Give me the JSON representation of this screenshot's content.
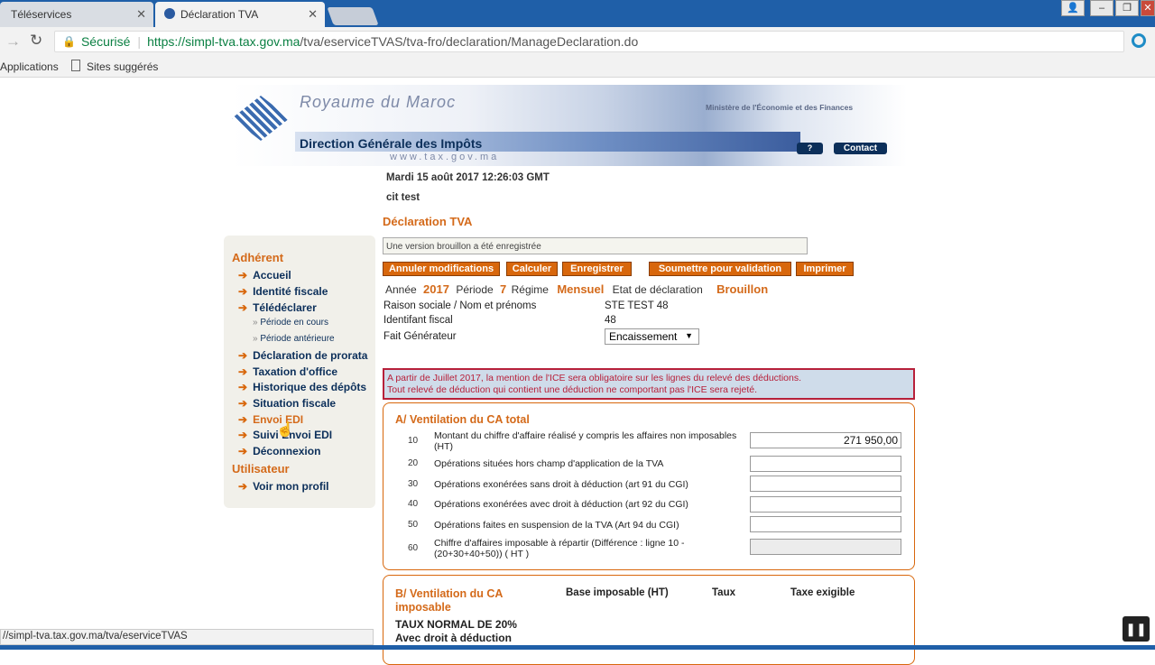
{
  "browser": {
    "tabs": [
      {
        "label": "Téléservices",
        "active": false
      },
      {
        "label": "Déclaration TVA",
        "active": true
      }
    ],
    "secure_label": "Sécurisé",
    "url_host": "https://simpl-tva.tax.gov.ma",
    "url_path": "/tva/eserviceTVAS/tva-fro/declaration/ManageDeclaration.do",
    "bookmarks": [
      "Applications",
      "Sites suggérés"
    ],
    "status_url": "//simpl-tva.tax.gov.ma/tva/eserviceTVAS"
  },
  "banner": {
    "kingdom": "Royaume du Maroc",
    "ministry": "Ministère de l'Économie et des Finances",
    "direction": "Direction Générale des Impôts",
    "website": "www.tax.gov.ma",
    "help_label": "?",
    "contact_label": "Contact"
  },
  "header": {
    "datetime": "Mardi 15 août 2017 12:26:03 GMT",
    "user": "cit test",
    "page_title": "Déclaration TVA"
  },
  "sidebar": {
    "section1": "Adhérent",
    "items": [
      "Accueil",
      "Identité fiscale",
      "Télédéclarer",
      "Déclaration de prorata",
      "Taxation d'office",
      "Historique des dépôts",
      "Situation fiscale",
      "Envoi EDI",
      "Suivi Envoi EDI",
      "Déconnexion"
    ],
    "subitems": [
      "Période en cours",
      "Période antérieure"
    ],
    "section2": "Utilisateur",
    "items2": [
      "Voir mon profil"
    ]
  },
  "notice": "Une version brouillon a été enregistrée",
  "buttons": {
    "cancel": "Annuler modifications",
    "calc": "Calculer",
    "save": "Enregistrer",
    "submit": "Soumettre pour validation",
    "print": "Imprimer"
  },
  "decl": {
    "annee_label": "Année",
    "annee": "2017",
    "periode_label": "Période",
    "periode": "7",
    "regime_label": "Régime",
    "regime": "Mensuel",
    "etat_label": "Etat de déclaration",
    "etat": "Brouillon",
    "raison_label": "Raison sociale / Nom et prénoms",
    "raison": "STE TEST 48",
    "if_label": "Identifant fiscal",
    "if": "48",
    "fait_label": "Fait Générateur",
    "fait": "Encaissement"
  },
  "alert": {
    "line1": "A partir de Juillet 2017, la mention de l'ICE sera obligatoire sur les lignes du relevé des déductions.",
    "line2": "Tout relevé de déduction qui contient une déduction ne comportant pas l'ICE sera rejeté."
  },
  "sectionA": {
    "title": "A/ Ventilation du CA total",
    "rows": [
      {
        "num": "10",
        "label": "Montant du chiffre d'affaire réalisé y compris les affaires non imposables (HT)",
        "value": "271 950,00"
      },
      {
        "num": "20",
        "label": "Opérations situées hors champ d'application de la TVA",
        "value": ""
      },
      {
        "num": "30",
        "label": "Opérations exonérées sans droit à déduction (art 91 du CGI)",
        "value": ""
      },
      {
        "num": "40",
        "label": "Opérations exonérées avec droit à déduction (art 92 du CGI)",
        "value": ""
      },
      {
        "num": "50",
        "label": "Opérations faites en suspension de la TVA (Art 94 du CGI)",
        "value": ""
      },
      {
        "num": "60",
        "label": "Chiffre d'affaires imposable à répartir (Différence : ligne 10 - (20+30+40+50)) ( HT )",
        "value": ""
      }
    ]
  },
  "sectionB": {
    "title": "B/ Ventilation du CA imposable",
    "col1": "Base imposable (HT)",
    "col2": "Taux",
    "col3": "Taxe exigible",
    "sub1": "TAUX NORMAL DE 20%",
    "sub2": "Avec droit à déduction"
  }
}
